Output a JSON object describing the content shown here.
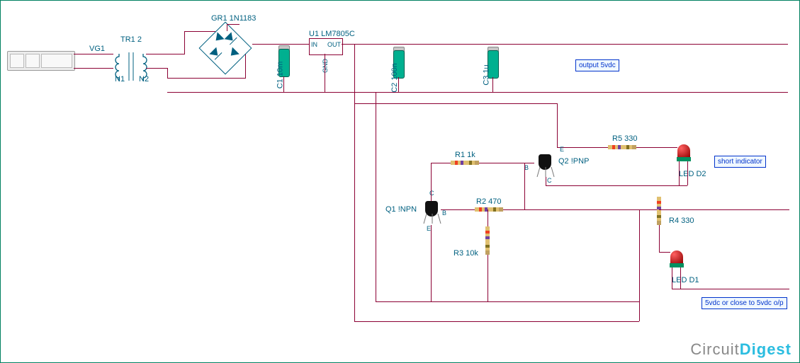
{
  "components": {
    "vg1": {
      "name": "VG1"
    },
    "tr1": {
      "name": "TR1 2",
      "n1": "N1",
      "n2": "N2"
    },
    "gr1": {
      "name": "GR1 1N1183"
    },
    "u1": {
      "name": "U1 LM7805C",
      "in": "IN",
      "out": "OUT",
      "gnd": "GND"
    },
    "c1": {
      "name": "C1 10m"
    },
    "c2": {
      "name": "C2 100n"
    },
    "c3": {
      "name": "C3 1u"
    },
    "q1": {
      "name": "Q1 !NPN",
      "c": "C",
      "b": "B",
      "e": "E"
    },
    "q2": {
      "name": "Q2 !PNP",
      "c": "C",
      "b": "B",
      "e": "E"
    },
    "r1": {
      "name": "R1 1k"
    },
    "r2": {
      "name": "R2 470"
    },
    "r3": {
      "name": "R3 10k"
    },
    "r4": {
      "name": "R4 330"
    },
    "r5": {
      "name": "R5 330"
    },
    "d1": {
      "name": "LED D1"
    },
    "d2": {
      "name": "LED D2"
    }
  },
  "annotations": {
    "output": "output 5vdc",
    "short": "short indicator",
    "out5v": "5vdc or close to 5vdc o/p"
  },
  "footer": {
    "a": "Circuit",
    "b": "Digest"
  }
}
